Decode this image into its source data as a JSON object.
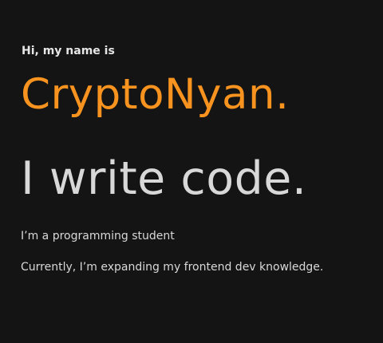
{
  "hero": {
    "greeting": "Hi, my name is",
    "name": "CryptoNyan.",
    "tagline": "I write code.",
    "description_1": "I’m a programming student",
    "description_2": "Currently, I’m expanding my frontend dev knowledge."
  },
  "colors": {
    "background": "#141414",
    "accent": "#f7931e",
    "text": "#d8d8d8"
  }
}
